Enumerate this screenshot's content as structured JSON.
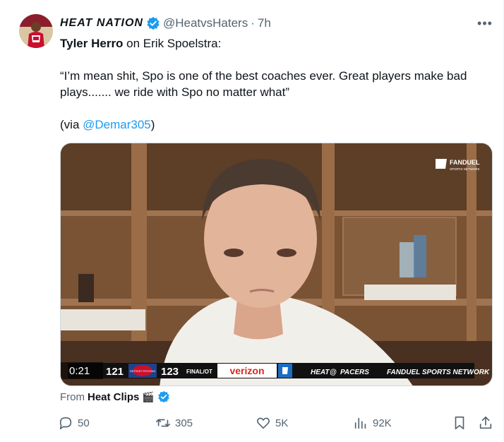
{
  "tweet": {
    "display_name": "HEAT NATION",
    "handle": "@HeatvsHaters",
    "separator": "·",
    "time": "7h",
    "more_label": "•••",
    "text_bold": "Tyler Herro",
    "text_rest": " on Erik Spoelstra:",
    "quote": "“I’m mean shit, Spo is one of the best coaches ever. Great players make bad plays....... we ride with Spo no matter what”",
    "via_prefix": "(via ",
    "via_link": "@Demar305",
    "via_suffix": ")"
  },
  "video": {
    "timestamp": "0:21",
    "score_left": "121",
    "team_logo_text": "DETROIT PISTONS",
    "score_right": "123",
    "game_status": "FINAL/OT",
    "sponsor": "verizon",
    "matchup_heat": "HEAT",
    "matchup_at": "@",
    "matchup_pacers": "PACERS",
    "network_bar": "FANDUEL SPORTS NETWORK",
    "bug_line1": "FANDUEL",
    "bug_line2": "SPORTS NETWORK"
  },
  "source": {
    "from_label": "From",
    "source_name": "Heat Clips",
    "emoji": "🎬"
  },
  "actions": {
    "replies": "50",
    "reposts": "305",
    "likes": "5K",
    "views": "92K"
  },
  "colors": {
    "link": "#1d9bf0",
    "muted": "#536471",
    "verified": "#1d9bf0"
  }
}
